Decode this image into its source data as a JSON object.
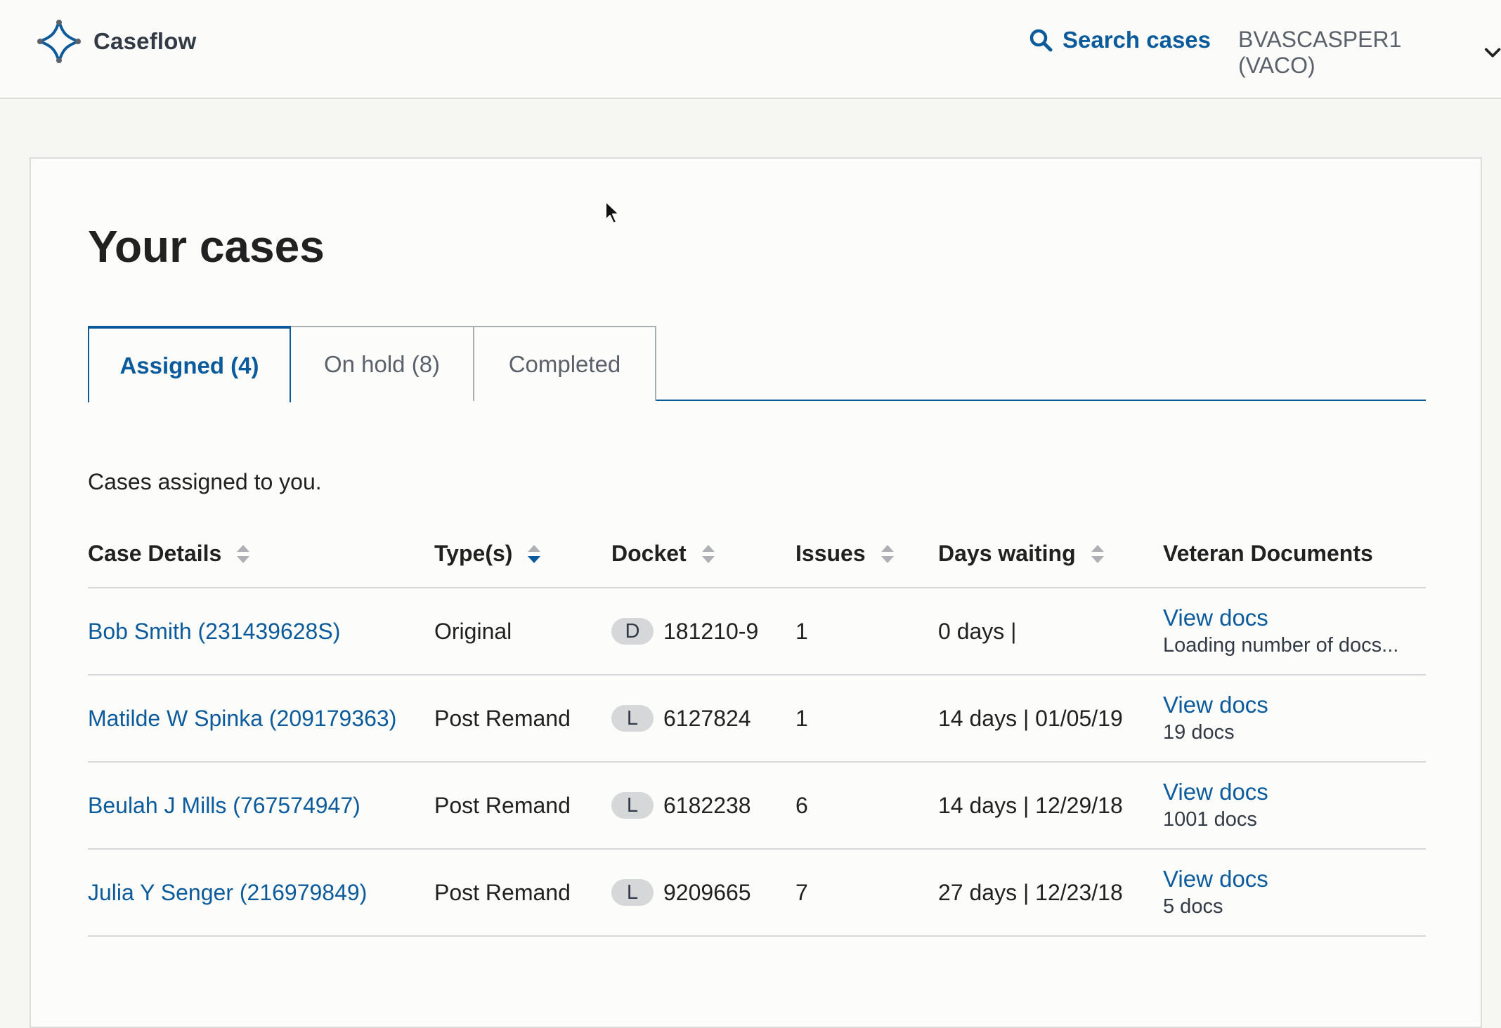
{
  "app": {
    "name": "Caseflow",
    "search_label": "Search cases",
    "user_label": "BVASCASPER1 (VACO)"
  },
  "page": {
    "title": "Your cases",
    "description": "Cases assigned to you."
  },
  "tabs": [
    {
      "label": "Assigned (4)",
      "active": true
    },
    {
      "label": "On hold (8)",
      "active": false
    },
    {
      "label": "Completed",
      "active": false
    }
  ],
  "table": {
    "headers": [
      "Case Details",
      "Type(s)",
      "Docket",
      "Issues",
      "Days waiting",
      "Veteran Documents"
    ],
    "rows": [
      {
        "case": "Bob Smith (231439628S)",
        "type": "Original",
        "docket_type": "D",
        "docket_number": "181210-9",
        "issues": "1",
        "days_waiting": "0 days |",
        "docs_link": "View docs",
        "docs_count": "Loading number of docs..."
      },
      {
        "case": "Matilde W Spinka (209179363)",
        "type": "Post Remand",
        "docket_type": "L",
        "docket_number": "6127824",
        "issues": "1",
        "days_waiting": "14 days | 01/05/19",
        "docs_link": "View docs",
        "docs_count": "19 docs"
      },
      {
        "case": "Beulah J Mills (767574947)",
        "type": "Post Remand",
        "docket_type": "L",
        "docket_number": "6182238",
        "issues": "6",
        "days_waiting": "14 days | 12/29/18",
        "docs_link": "View docs",
        "docs_count": "1001 docs"
      },
      {
        "case": "Julia Y Senger (216979849)",
        "type": "Post Remand",
        "docket_type": "L",
        "docket_number": "9209665",
        "issues": "7",
        "days_waiting": "27 days | 12/23/18",
        "docs_link": "View docs",
        "docs_count": "5 docs"
      }
    ]
  },
  "icons": {
    "logo": "caseflow-logo-icon",
    "search": "search-icon",
    "chevron": "chevron-down-icon",
    "sort": "sort-icon",
    "cursor": "mouse-cursor-icon"
  },
  "colors": {
    "primary": "#0b5b9c",
    "text": "#212121",
    "muted": "#5b616b",
    "badge": "#d6d7d9",
    "background": "#f6f6f3",
    "sort_inactive": "#aeb0b5"
  }
}
